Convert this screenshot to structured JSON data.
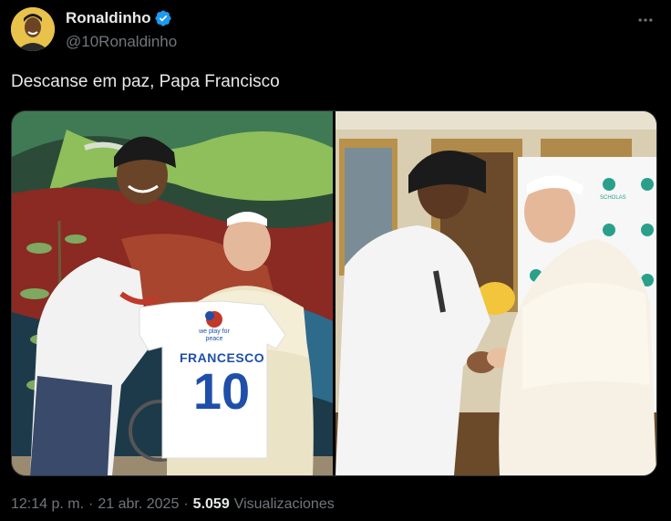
{
  "author": {
    "display_name": "Ronaldinho",
    "handle": "@10Ronaldinho",
    "verified": true,
    "avatar_icon": "profile-photo"
  },
  "tweet": {
    "text": "Descanse em paz, Papa Francisco"
  },
  "media": {
    "photos": [
      {
        "jersey_name": "FRANCESCO",
        "jersey_number": "10",
        "jersey_logo_text": "we play for peace"
      },
      {
        "banner_text": "SCHOLAS"
      }
    ]
  },
  "meta": {
    "time": "12:14 p. m.",
    "separator": "·",
    "date": "21 abr. 2025",
    "views_count": "5.059",
    "views_label": "Visualizaciones"
  },
  "colors": {
    "verified": "#1d9bf0",
    "background": "#000000",
    "secondary_text": "#71767b"
  }
}
